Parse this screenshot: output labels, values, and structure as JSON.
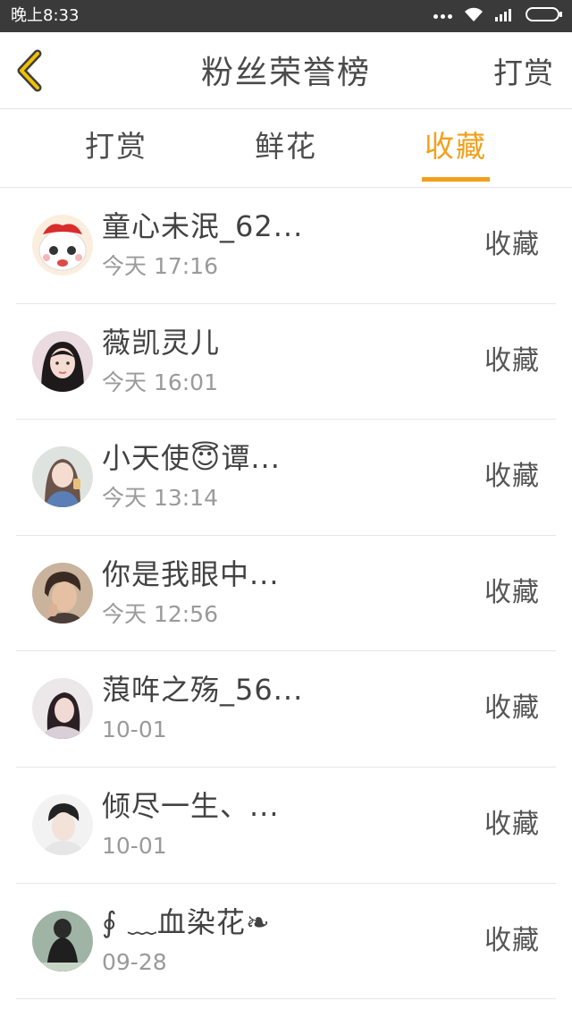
{
  "status_bar": {
    "time": "晚上8:33",
    "icons": [
      "dots-icon",
      "wifi-icon",
      "signal-icon",
      "battery-icon"
    ]
  },
  "header": {
    "title": "粉丝荣誉榜",
    "action_label": "打赏"
  },
  "tabs": [
    {
      "label": "打赏",
      "active": false
    },
    {
      "label": "鲜花",
      "active": false
    },
    {
      "label": "收藏",
      "active": true
    }
  ],
  "accent_color": "#f2a01b",
  "list": [
    {
      "name": "童心未泯_62...",
      "time": "今天 17:16",
      "action": "收藏"
    },
    {
      "name": "薇凯灵儿",
      "time": "今天 16:01",
      "action": "收藏"
    },
    {
      "name": "小天使😇谭...",
      "time": "今天 13:14",
      "action": "收藏"
    },
    {
      "name": "你是我眼中...",
      "time": "今天 12:56",
      "action": "收藏"
    },
    {
      "name": "蒗哖之殇_56...",
      "time": "10-01",
      "action": "收藏"
    },
    {
      "name": "倾尽一生、...",
      "time": "10-01",
      "action": "收藏"
    },
    {
      "name": "∮ ﹏血染花❧",
      "time": "09-28",
      "action": "收藏"
    }
  ]
}
